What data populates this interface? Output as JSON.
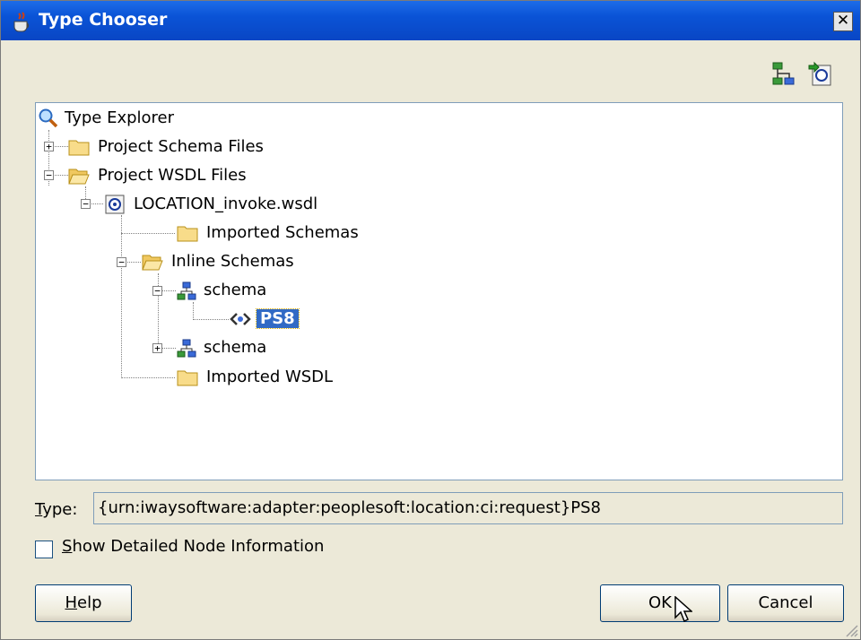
{
  "window": {
    "title": "Type Chooser",
    "close_label": "✕"
  },
  "toolbar": {
    "icons": [
      "hierarchy-view-icon",
      "import-icon"
    ]
  },
  "tree": {
    "root": "Type Explorer",
    "project_schema_files": "Project Schema Files",
    "project_wsdl_files": "Project WSDL Files",
    "wsdl_file": "LOCATION_invoke.wsdl",
    "imported_schemas": "Imported Schemas",
    "inline_schemas": "Inline Schemas",
    "schema_1": "schema",
    "ps8": "PS8",
    "schema_2": "schema",
    "imported_wsdl": "Imported WSDL"
  },
  "type_field": {
    "label_first": "T",
    "label_rest": "ype:",
    "value": "{urn:iwaysoftware:adapter:peoplesoft:location:ci:request}PS8"
  },
  "show_detail": {
    "label_first": "S",
    "label_rest": "how Detailed Node Information",
    "checked": false
  },
  "buttons": {
    "help_first": "H",
    "help_rest": "elp",
    "ok": "OK",
    "cancel": "Cancel"
  }
}
